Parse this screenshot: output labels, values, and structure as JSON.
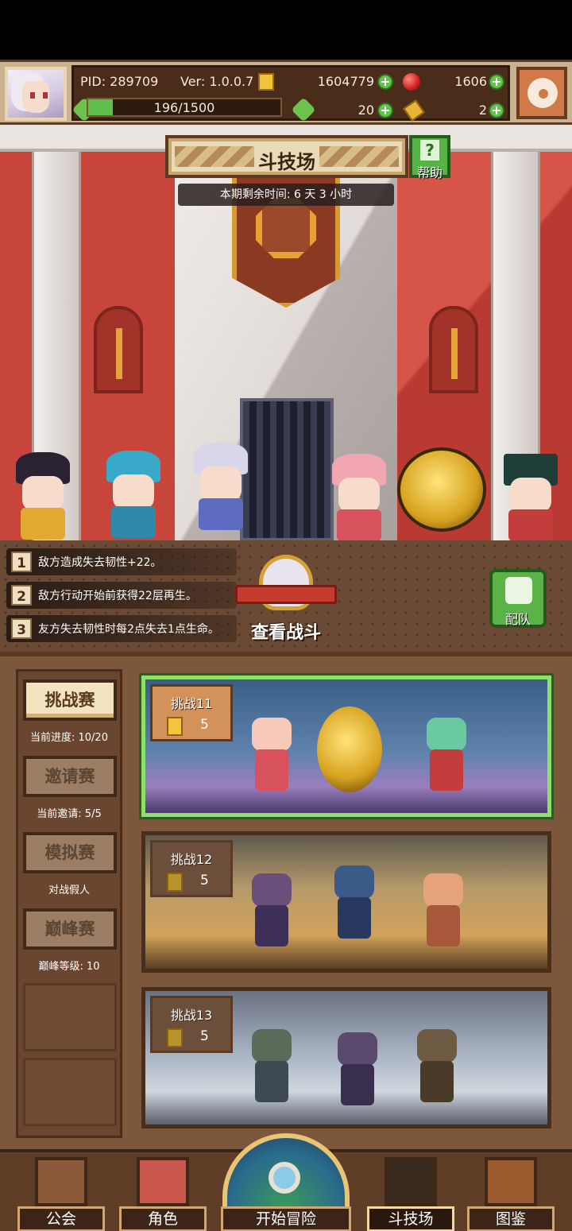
{
  "hud": {
    "pid": "PID: 289709",
    "version": "Ver: 1.0.0.7",
    "gold": "1604779",
    "gems": "1606",
    "stamina": "196/1500",
    "stamina_fraction": 0.13,
    "clover_count": "20",
    "key_count": "2"
  },
  "arena": {
    "title": "斗技场",
    "help_label": "帮助",
    "timer": "本期剩余时间: 6 天 3 小时"
  },
  "effects": [
    {
      "num": "1",
      "text": "敌方造成失去韧性+22。"
    },
    {
      "num": "2",
      "text": "敌方行动开始前获得22层再生。"
    },
    {
      "num": "3",
      "text": "友方失去韧性时每2点失去1点生命。"
    }
  ],
  "view_battle": "查看战斗",
  "team_label": "配队",
  "modes": [
    {
      "label": "挑战赛",
      "sub": "当前进度: 10/20"
    },
    {
      "label": "邀请赛",
      "sub": "当前邀请: 5/5"
    },
    {
      "label": "模拟赛",
      "sub": "对战假人"
    },
    {
      "label": "巅峰赛",
      "sub": "巅峰等级: 10"
    }
  ],
  "challenges": [
    {
      "title": "挑战11",
      "cost": "5"
    },
    {
      "title": "挑战12",
      "cost": "5"
    },
    {
      "title": "挑战13",
      "cost": "5"
    }
  ],
  "nav": {
    "guild": "公会",
    "character": "角色",
    "start_adventure": "开始冒险",
    "arena": "斗技场",
    "codex": "图鉴"
  },
  "colors": {
    "accent_green": "#5bb246",
    "panel_brown": "#7d573b",
    "arena_red": "#c9453c"
  }
}
